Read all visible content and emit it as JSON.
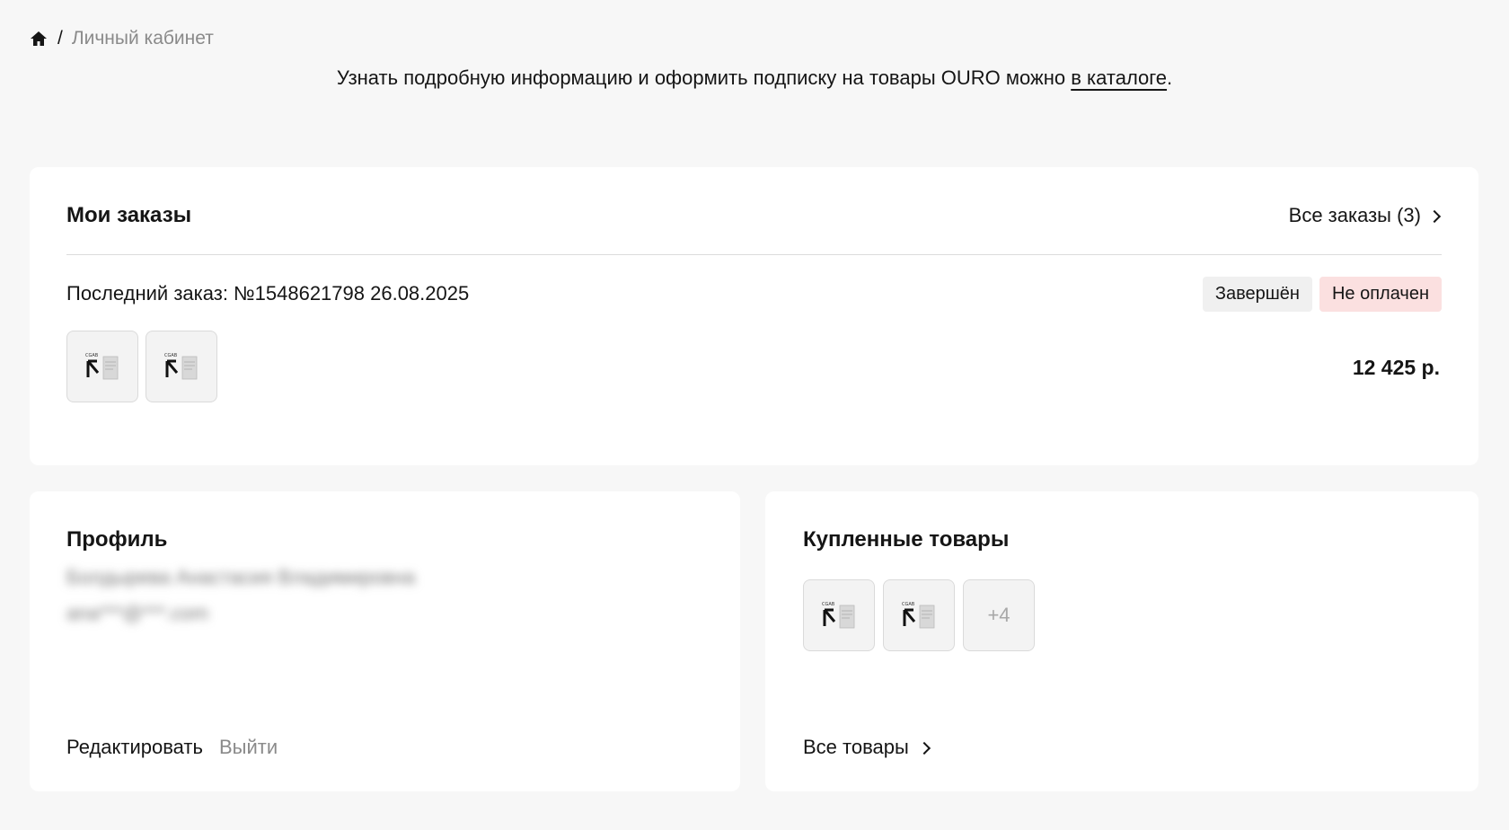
{
  "breadcrumb": {
    "home_icon": "home-icon",
    "separator": "/",
    "current": "Личный кабинет"
  },
  "notice": {
    "text_before": "Узнать подробную информацию и оформить подписку на товары OURO можно ",
    "link": "в каталоге",
    "text_after": "."
  },
  "orders": {
    "title": "Мои заказы",
    "all_link": "Все заказы (3)",
    "last_order": "Последний заказ: №1548621798 26.08.2025",
    "status_done": "Завершён",
    "status_unpaid": "Не оплачен",
    "total": "12 425 р.",
    "thumbnail_count": 2
  },
  "profile": {
    "title": "Профиль",
    "name_blurred": "Болдырева Анастасия Владимировна",
    "email_blurred": "ana***@***.com",
    "edit": "Редактировать",
    "logout": "Выйти"
  },
  "purchased": {
    "title": "Купленные товары",
    "more_badge": "+4",
    "all_goods": "Все товары"
  },
  "colors": {
    "background": "#f7f7f7",
    "card": "#ffffff",
    "unpaid_badge": "#fbe0e0",
    "done_badge": "#f0f0f0",
    "muted_text": "#8a8a8a"
  }
}
